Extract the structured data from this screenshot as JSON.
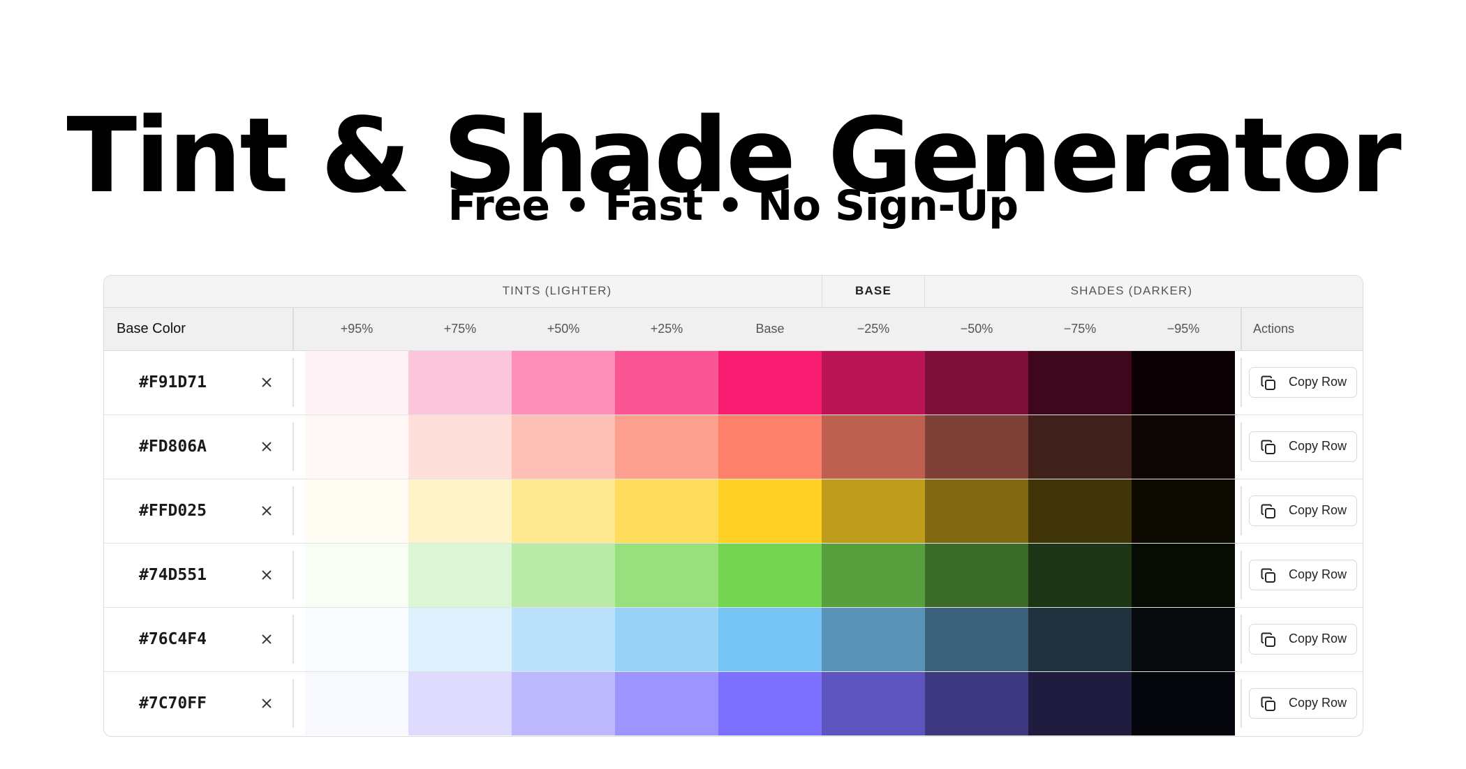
{
  "header": {
    "title": "Tint & Shade Generator",
    "subtitle": "Free • Fast • No Sign-Up"
  },
  "table": {
    "groups": {
      "tints": "TINTS (LIGHTER)",
      "base": "BASE",
      "shades": "SHADES (DARKER)"
    },
    "columns": {
      "base_color": "Base Color",
      "steps": [
        "+95%",
        "+75%",
        "+50%",
        "+25%",
        "Base",
        "−25%",
        "−50%",
        "−75%",
        "−95%"
      ],
      "actions": "Actions"
    },
    "remove_icon": "close-icon",
    "copy_icon": "copy-icon",
    "copy_label": "Copy Row",
    "rows": [
      {
        "hex": "#F91D71",
        "swatches": [
          "#FFF3F7",
          "#FEC6DC",
          "#FC8EB8",
          "#FA5694",
          "#F91D71",
          "#BA1655",
          "#7D0F38",
          "#3E071C",
          "#0C0206"
        ]
      },
      {
        "hex": "#FD806A",
        "swatches": [
          "#FFF8F7",
          "#FFDFDA",
          "#FEC0B4",
          "#FEA08F",
          "#FD806A",
          "#BE6050",
          "#7F4035",
          "#3F201B",
          "#0D0605"
        ]
      },
      {
        "hex": "#FFD025",
        "swatches": [
          "#FFFCF4",
          "#FFF3C9",
          "#FFE892",
          "#FFDC5C",
          "#FFD025",
          "#BF9C1C",
          "#806812",
          "#403409",
          "#0D0A02"
        ]
      },
      {
        "hex": "#74D551",
        "swatches": [
          "#F8FDF6",
          "#DCF5D4",
          "#BAEAA8",
          "#97E07D",
          "#74D551",
          "#57A03D",
          "#3A6B29",
          "#1D3514",
          "#060B04"
        ]
      },
      {
        "hex": "#76C4F4",
        "swatches": [
          "#F8FCFF",
          "#DDF0FC",
          "#BBE2FA",
          "#98D3F7",
          "#76C4F4",
          "#5993B7",
          "#3B627A",
          "#1E313D",
          "#060A0C"
        ]
      },
      {
        "hex": "#7C70FF",
        "swatches": [
          "#F8F8FF",
          "#DEDBFF",
          "#BEB8FF",
          "#9D94FF",
          "#7C70FF",
          "#5D54BF",
          "#3E3880",
          "#1F1C40",
          "#06060D"
        ]
      }
    ]
  }
}
